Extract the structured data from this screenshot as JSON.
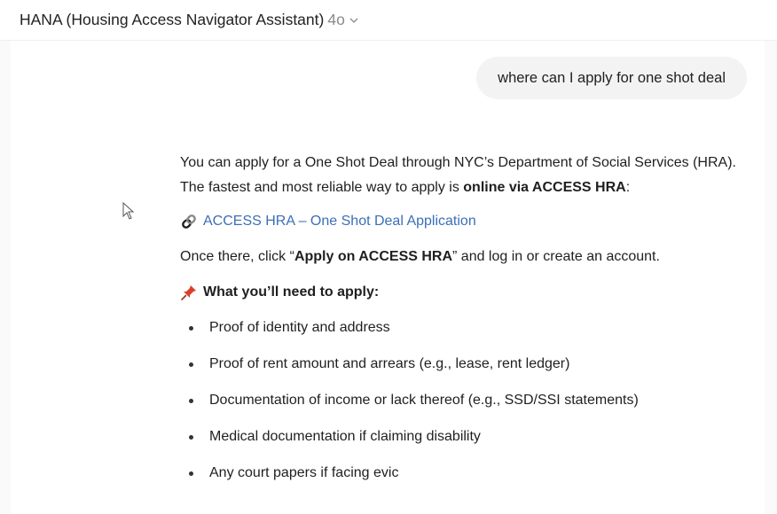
{
  "header": {
    "title": "HANA (Housing Access Navigator Assistant)",
    "model_version": "4o",
    "dropdown_icon": "chevron-down-icon"
  },
  "user_message": {
    "text": "where can I apply for one shot deal"
  },
  "assistant_message": {
    "line1": "You can apply for a One Shot Deal through NYC’s Department of Social Services (HRA).",
    "line2_prefix": "The fastest and most reliable way to apply is ",
    "line2_bold": "online via ACCESS HRA",
    "line2_suffix": ":",
    "link_icon": "link-icon",
    "link_text": "ACCESS HRA – One Shot Deal Application",
    "line3_prefix": "Once there, click “",
    "line3_bold": "Apply on ACCESS HRA",
    "line3_suffix": "” and log in or create an account.",
    "need_icon": "pushpin-icon",
    "need_heading": "What you’ll need to apply:",
    "requirements": [
      "Proof of identity and address",
      "Proof of rent amount and arrears (e.g., lease, rent ledger)",
      "Documentation of income or lack thereof (e.g., SSD/SSI statements)",
      "Medical documentation if claiming disability",
      "Any court papers if facing evic"
    ]
  },
  "colors": {
    "link": "#3b6fb6",
    "user_bubble": "#f3f3f3",
    "muted": "#8a8a8a"
  }
}
